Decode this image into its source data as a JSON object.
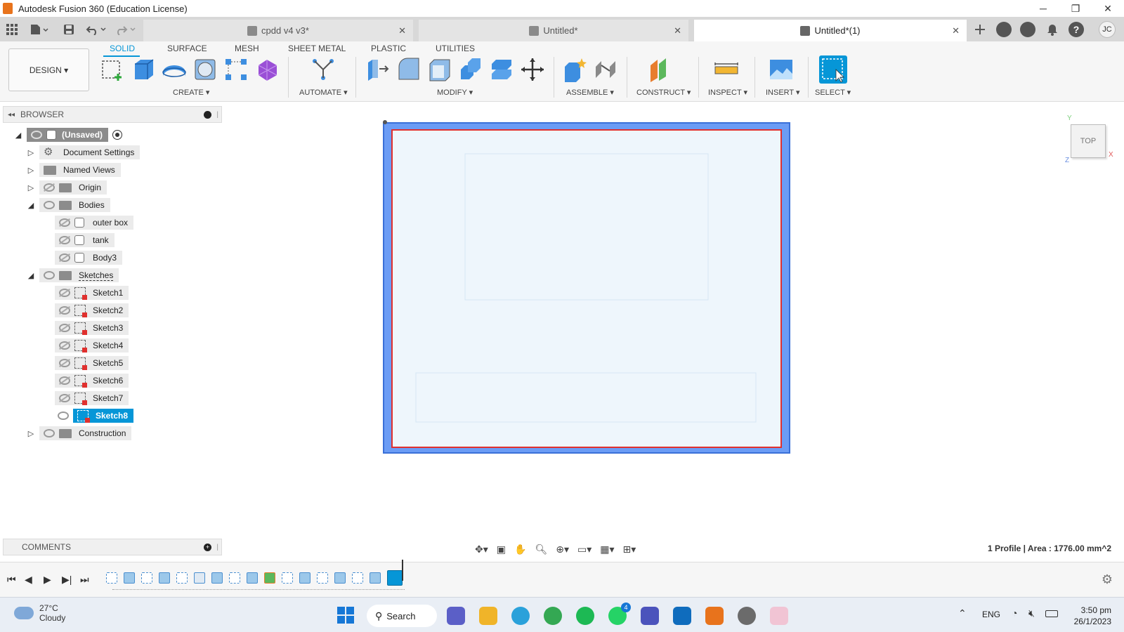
{
  "titlebar": {
    "title": "Autodesk Fusion 360 (Education License)",
    "minimize": "─",
    "restore": "❐",
    "close": "✕"
  },
  "tabs": [
    {
      "label": "cpdd v4 v3*",
      "close": "✕",
      "active": false
    },
    {
      "label": "Untitled*",
      "close": "✕",
      "active": false
    },
    {
      "label": "Untitled*(1)",
      "close": "✕",
      "active": true
    }
  ],
  "user": {
    "initials": "JC"
  },
  "toolbar": {
    "workspace": "DESIGN ▾",
    "workspace_tabs": [
      "SOLID",
      "SURFACE",
      "MESH",
      "SHEET METAL",
      "PLASTIC",
      "UTILITIES"
    ],
    "groups": [
      "CREATE ▾",
      "AUTOMATE ▾",
      "MODIFY ▾",
      "ASSEMBLE ▾",
      "CONSTRUCT ▾",
      "INSPECT ▾",
      "INSERT ▾",
      "SELECT ▾"
    ]
  },
  "browser": {
    "title": "BROWSER",
    "root": "(Unsaved)",
    "items": [
      {
        "label": "Document Settings"
      },
      {
        "label": "Named Views"
      },
      {
        "label": "Origin"
      },
      {
        "label": "Bodies"
      },
      {
        "label": "outer box"
      },
      {
        "label": "tank"
      },
      {
        "label": "Body3"
      },
      {
        "label": "Sketches"
      },
      {
        "label": "Sketch1"
      },
      {
        "label": "Sketch2"
      },
      {
        "label": "Sketch3"
      },
      {
        "label": "Sketch4"
      },
      {
        "label": "Sketch5"
      },
      {
        "label": "Sketch6"
      },
      {
        "label": "Sketch7"
      },
      {
        "label": "Sketch8"
      },
      {
        "label": "Construction"
      }
    ]
  },
  "viewcube": {
    "face": "TOP",
    "axis_x": "X",
    "axis_y": "Y",
    "axis_z": "Z"
  },
  "comments": {
    "title": "COMMENTS"
  },
  "status": {
    "text": "1 Profile | Area : 1776.00 mm^2"
  },
  "taskbar": {
    "weather_temp": "27°C",
    "weather_desc": "Cloudy",
    "search": "Search",
    "lang": "ENG",
    "time": "3:50 pm",
    "date": "26/1/2023",
    "whatsapp_badge": "4"
  },
  "colors": {
    "accent": "#0696d7",
    "sketch_fill": "#6b9cf5",
    "profile_red": "#e0302e",
    "inner_fill": "#eef6fc"
  }
}
